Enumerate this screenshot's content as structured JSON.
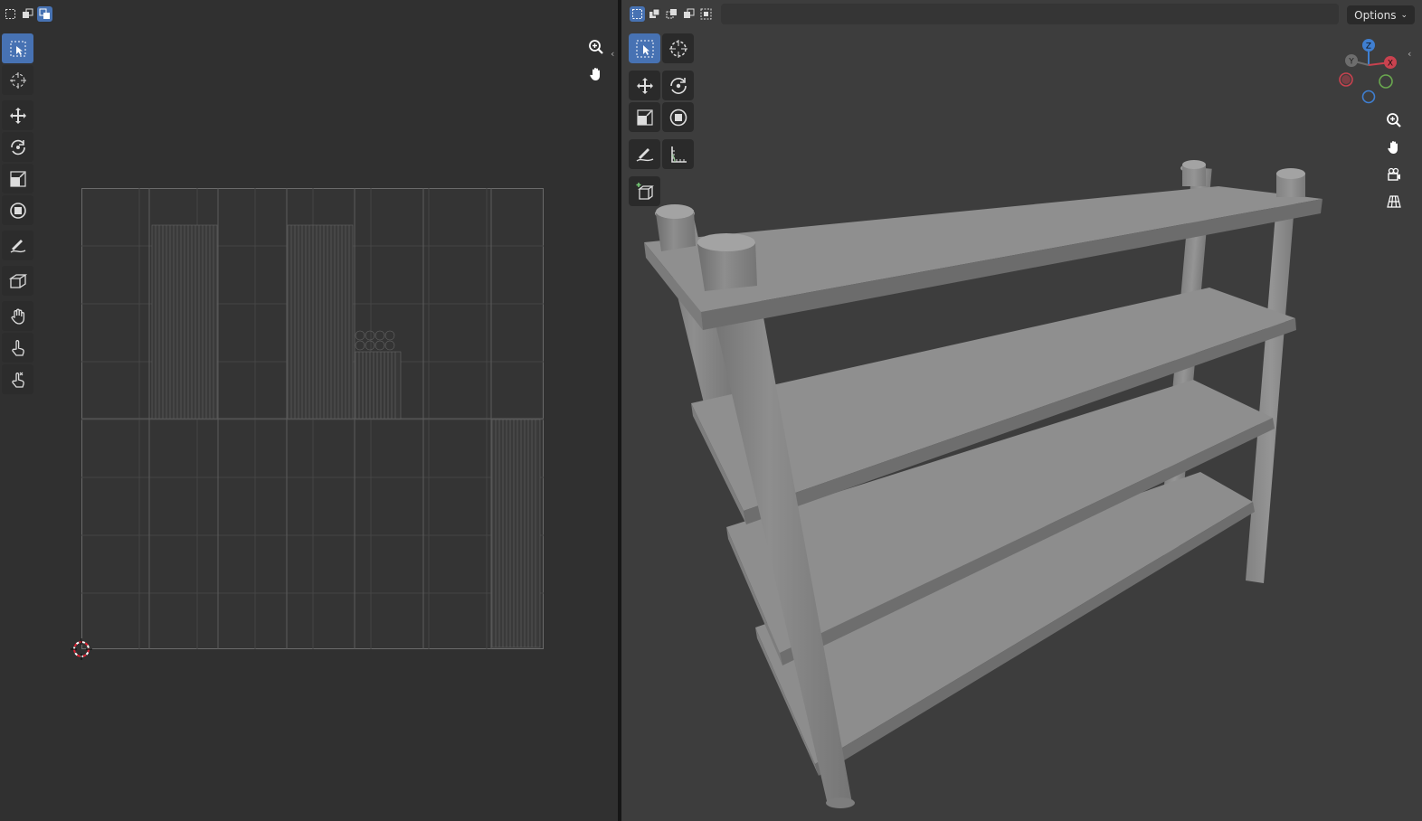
{
  "uv_editor": {
    "select_modes": [
      "vertex-select-icon",
      "edge-select-icon",
      "face-select-icon"
    ],
    "active_select_mode": "face-select-icon",
    "tools": [
      {
        "name": "select-box-tool",
        "icon": "select-box-icon",
        "active": true
      },
      {
        "name": "cursor-tool",
        "icon": "cursor-icon",
        "active": false
      },
      {
        "name": "move-tool",
        "icon": "move-icon",
        "active": false
      },
      {
        "name": "rotate-tool",
        "icon": "rotate-icon",
        "active": false
      },
      {
        "name": "scale-tool",
        "icon": "scale-icon",
        "active": false
      },
      {
        "name": "transform-tool",
        "icon": "transform-icon",
        "active": false
      },
      {
        "name": "annotate-tool",
        "icon": "annotate-icon",
        "active": false
      },
      {
        "name": "rip-region-tool",
        "icon": "rip-region-icon",
        "active": false
      },
      {
        "name": "grab-tool",
        "icon": "grab-icon",
        "active": false
      },
      {
        "name": "relax-tool",
        "icon": "relax-icon",
        "active": false
      },
      {
        "name": "pinch-tool",
        "icon": "pinch-icon",
        "active": false
      }
    ],
    "nav_buttons": [
      "zoom-icon",
      "pan-hand-icon"
    ]
  },
  "viewport": {
    "select_modes": [
      "select-new-icon",
      "select-extend-icon",
      "select-subtract-icon",
      "select-invert-icon",
      "select-intersect-icon"
    ],
    "options_label": "Options",
    "tools": [
      [
        {
          "name": "select-box-tool",
          "active": true
        },
        {
          "name": "cursor-tool",
          "active": false
        }
      ],
      [
        {
          "name": "move-tool",
          "active": false
        },
        {
          "name": "rotate-tool",
          "active": false
        }
      ],
      [
        {
          "name": "scale-tool",
          "active": false
        },
        {
          "name": "transform-tool",
          "active": false
        }
      ],
      [
        {
          "name": "annotate-tool",
          "active": false
        },
        {
          "name": "measure-tool",
          "active": false
        }
      ],
      [
        {
          "name": "add-cube-tool",
          "active": false
        }
      ]
    ],
    "gizmo": {
      "x_label": "X",
      "y_label": "Y",
      "z_label": "Z",
      "x_color": "#c9424f",
      "y_color": "#6aa84f",
      "z_color": "#3f7fd1"
    },
    "nav_buttons": [
      "zoom-icon",
      "pan-hand-icon",
      "camera-view-icon",
      "perspective-grid-icon"
    ]
  },
  "colors": {
    "accent": "#4772b3",
    "bg_uv": "#303030",
    "bg_viewport": "#3d3d3d",
    "object_grey": "#8e8e8e"
  }
}
